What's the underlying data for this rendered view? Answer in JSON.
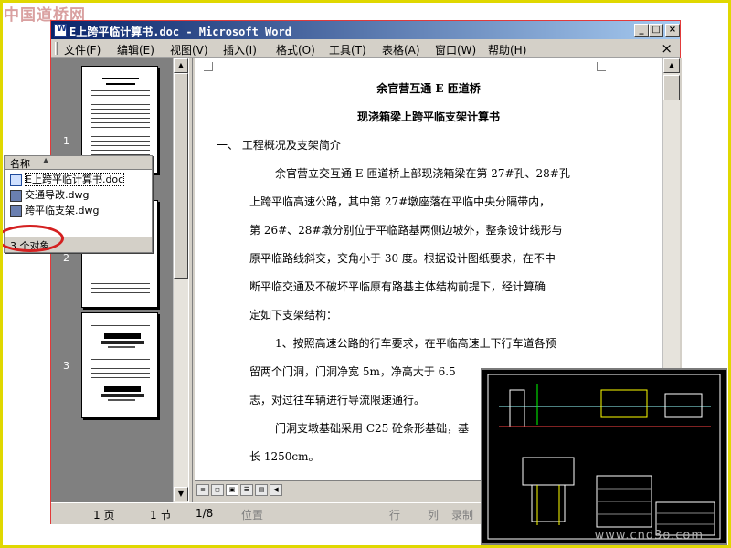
{
  "watermarks": {
    "site_cn": "中国道桥网",
    "site_url": "www.cnd3o.com"
  },
  "window": {
    "title": "E上跨平临计算书.doc - Microsoft Word",
    "buttons": {
      "minimize": "_",
      "maximize": "□",
      "close": "×"
    }
  },
  "menu": {
    "items": [
      "文件(F)",
      "编辑(E)",
      "视图(V)",
      "插入(I)",
      "格式(O)",
      "工具(T)",
      "表格(A)",
      "窗口(W)",
      "帮助(H)"
    ],
    "close": "×"
  },
  "thumbnails": {
    "pages": [
      "1",
      "2",
      "3"
    ]
  },
  "document": {
    "title1": "余官营互通 E 匝道桥",
    "title2": "现浇箱梁上跨平临支架计算书",
    "lines": [
      "一、  工程概况及支架简介",
      "余官营立交互通 E 匝道桥上部现浇箱梁在第 27#孔、28#孔",
      "上跨平临高速公路，其中第  27#墩座落在平临中央分隔带内，",
      "第 26#、28#墩分别位于平临路基两侧边坡外，整条设计线形与",
      "原平临路线斜交，交角小于 30 度。根据设计图纸要求，在不中",
      "断平临交通及不破坏平临原有路基主体结构前提下，经计算确",
      "定如下支架结构：",
      "1、按照高速公路的行车要求，在平临高速上下行车道各预",
      "留两个门洞，门洞净宽 5m，净高大于 6.5",
      "志，对过往车辆进行导流限速通行。",
      "门洞支墩基础采用 C25 砼条形基础，基",
      "长 1250cm。"
    ]
  },
  "status_bar": {
    "page": "1 页",
    "section": "1 节",
    "page_of": "1/8",
    "position": "位置",
    "line": "行",
    "column": "列",
    "record": "录制"
  },
  "file_list": {
    "header": "名称",
    "files": [
      {
        "name": "E上跨平临计算书.doc",
        "type": "doc"
      },
      {
        "name": "交通导改.dwg",
        "type": "dwg"
      },
      {
        "name": "跨平临支架.dwg",
        "type": "dwg"
      }
    ],
    "status": "3 个对象"
  },
  "colors": {
    "titlebar_start": "#0a246a",
    "titlebar_end": "#a6caf0",
    "highlight_ellipse": "#d42020",
    "frame_border": "#e0d800",
    "cad_background": "#000000"
  },
  "icons": {
    "doc": "word-document-icon",
    "dwg": "cad-drawing-icon",
    "sort": "sort-ascending-icon"
  }
}
